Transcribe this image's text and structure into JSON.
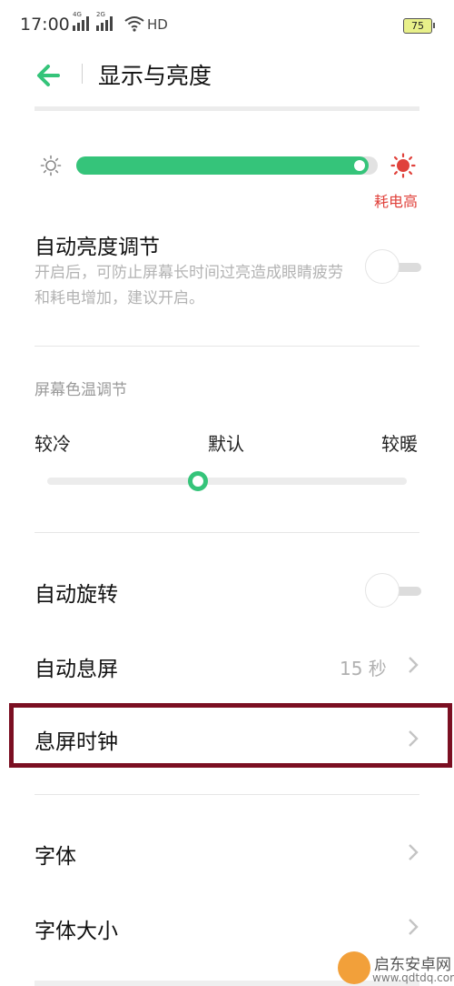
{
  "status_bar": {
    "time": "17:00",
    "signal1_gen": "4G",
    "signal2_gen": "2G",
    "network": "HD",
    "battery": "75"
  },
  "header": {
    "title": "显示与亮度"
  },
  "brightness": {
    "level": 0.97,
    "warning": "耗电高",
    "accent": "#35c47a",
    "warning_color": "#e0413b"
  },
  "auto_brightness": {
    "title": "自动亮度调节",
    "description": "开启后，可防止屏幕长时间过亮造成眼睛疲劳和耗电增加，建议开启。",
    "enabled": false
  },
  "color_temp": {
    "section_label": "屏幕色温调节",
    "cold": "较冷",
    "default": "默认",
    "warm": "较暖",
    "level": 0.42
  },
  "auto_rotate": {
    "title": "自动旋转",
    "enabled": false
  },
  "screen_timeout": {
    "title": "自动息屏",
    "value": "15 秒"
  },
  "aod_clock": {
    "title": "息屏时钟"
  },
  "font": {
    "title": "字体"
  },
  "font_size": {
    "title": "字体大小"
  },
  "watermark": {
    "name": "启东安卓网",
    "url": "www.qdtdq.com"
  },
  "icons": [
    "back-arrow-icon",
    "sun-small-icon",
    "sun-big-icon",
    "chevron-right-icon",
    "wifi-icon"
  ]
}
